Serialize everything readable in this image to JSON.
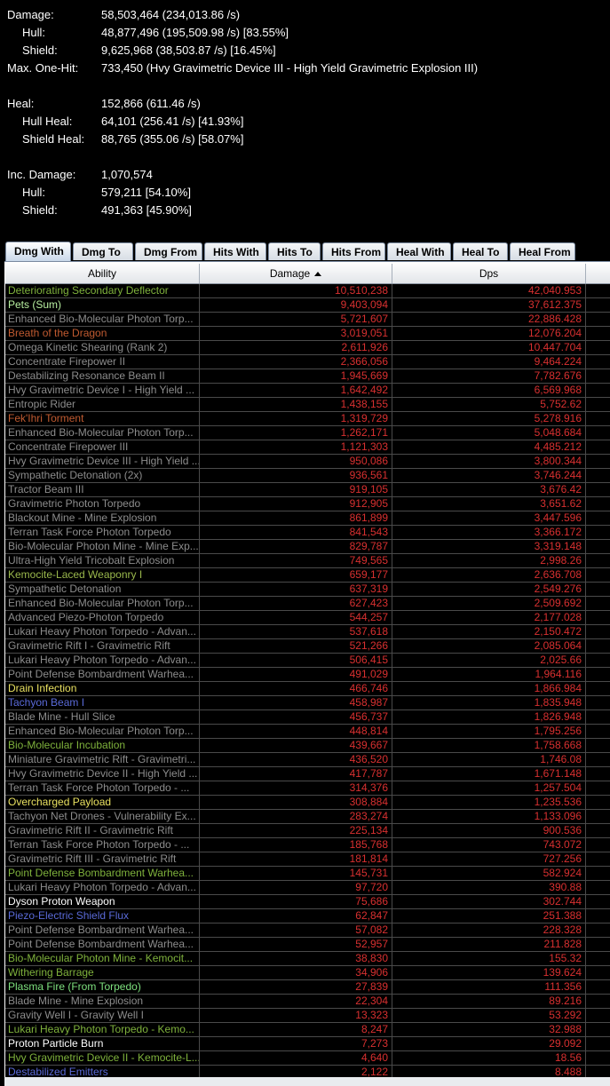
{
  "summary": {
    "damage": {
      "label": "Damage:",
      "value": "58,503,464 (234,013.86 /s)"
    },
    "damage_hull": {
      "label": "Hull:",
      "value": "48,877,496 (195,509.98 /s) [83.55%]"
    },
    "damage_shield": {
      "label": "Shield:",
      "value": "9,625,968 (38,503.87 /s) [16.45%]"
    },
    "max_one_hit": {
      "label": "Max. One-Hit:",
      "value": "733,450 (Hvy Gravimetric Device III - High Yield Gravimetric Explosion III)"
    },
    "heal": {
      "label": "Heal:",
      "value": "152,866 (611.46 /s)"
    },
    "hull_heal": {
      "label": "Hull Heal:",
      "value": "64,101 (256.41 /s) [41.93%]"
    },
    "shield_heal": {
      "label": "Shield Heal:",
      "value": "88,765 (355.06 /s) [58.07%]"
    },
    "inc_damage": {
      "label": "Inc. Damage:",
      "value": "1,070,574"
    },
    "inc_hull": {
      "label": "Hull:",
      "value": "579,211 [54.10%]"
    },
    "inc_shield": {
      "label": "Shield:",
      "value": "491,363 [45.90%]"
    }
  },
  "tabs": [
    {
      "label": "Dmg With",
      "active": true
    },
    {
      "label": "Dmg To"
    },
    {
      "label": "Dmg From"
    },
    {
      "label": "Hits With"
    },
    {
      "label": "Hits To"
    },
    {
      "label": "Hits From"
    },
    {
      "label": "Heal With"
    },
    {
      "label": "Heal To"
    },
    {
      "label": "Heal From"
    }
  ],
  "table": {
    "columns": [
      "Ability",
      "Damage",
      "Dps"
    ],
    "sort": {
      "column": "Damage",
      "direction": "descending"
    },
    "rows": [
      {
        "ability": "Deteriorating Secondary Deflector",
        "damage": "10,510,238",
        "dps": "42,040.953",
        "color": "#7fb23c"
      },
      {
        "ability": "Pets (Sum)",
        "damage": "9,403,094",
        "dps": "37,612.375",
        "color": "#b8f0a0"
      },
      {
        "ability": "Enhanced Bio-Molecular Photon Torp...",
        "damage": "5,721,607",
        "dps": "22,886.428",
        "color": "#8c8c8c"
      },
      {
        "ability": "Breath of the Dragon",
        "damage": "3,019,051",
        "dps": "12,076.204",
        "color": "#c05a30"
      },
      {
        "ability": "Omega Kinetic Shearing (Rank 2)",
        "damage": "2,611,926",
        "dps": "10,447.704",
        "color": "#8c8c8c"
      },
      {
        "ability": "Concentrate Firepower II",
        "damage": "2,366,056",
        "dps": "9,464.224",
        "color": "#8c8c8c"
      },
      {
        "ability": "Destabilizing Resonance Beam II",
        "damage": "1,945,669",
        "dps": "7,782.676",
        "color": "#8c8c8c"
      },
      {
        "ability": "Hvy Gravimetric Device I - High Yield ...",
        "damage": "1,642,492",
        "dps": "6,569.968",
        "color": "#8c8c8c"
      },
      {
        "ability": "Entropic Rider",
        "damage": "1,438,155",
        "dps": "5,752.62",
        "color": "#8c8c8c"
      },
      {
        "ability": "Fek'Ihri Torment",
        "damage": "1,319,729",
        "dps": "5,278.916",
        "color": "#c05a30"
      },
      {
        "ability": "Enhanced Bio-Molecular Photon Torp...",
        "damage": "1,262,171",
        "dps": "5,048.684",
        "color": "#8c8c8c"
      },
      {
        "ability": "Concentrate Firepower III",
        "damage": "1,121,303",
        "dps": "4,485.212",
        "color": "#8c8c8c"
      },
      {
        "ability": "Hvy Gravimetric Device III - High Yield ...",
        "damage": "950,086",
        "dps": "3,800.344",
        "color": "#8c8c8c"
      },
      {
        "ability": "Sympathetic Detonation (2x)",
        "damage": "936,561",
        "dps": "3,746.244",
        "color": "#8c8c8c"
      },
      {
        "ability": "Tractor Beam III",
        "damage": "919,105",
        "dps": "3,676.42",
        "color": "#8c8c8c"
      },
      {
        "ability": "Gravimetric Photon Torpedo",
        "damage": "912,905",
        "dps": "3,651.62",
        "color": "#8c8c8c"
      },
      {
        "ability": "Blackout Mine - Mine Explosion",
        "damage": "861,899",
        "dps": "3,447.596",
        "color": "#8c8c8c"
      },
      {
        "ability": "Terran Task Force Photon Torpedo",
        "damage": "841,543",
        "dps": "3,366.172",
        "color": "#8c8c8c"
      },
      {
        "ability": "Bio-Molecular Photon Mine - Mine Exp...",
        "damage": "829,787",
        "dps": "3,319.148",
        "color": "#8c8c8c"
      },
      {
        "ability": "Ultra-High Yield Tricobalt Explosion",
        "damage": "749,565",
        "dps": "2,998.26",
        "color": "#8c8c8c"
      },
      {
        "ability": "Kemocite-Laced Weaponry I",
        "damage": "659,177",
        "dps": "2,636.708",
        "color": "#9ab84c"
      },
      {
        "ability": "Sympathetic Detonation",
        "damage": "637,319",
        "dps": "2,549.276",
        "color": "#8c8c8c"
      },
      {
        "ability": "Enhanced Bio-Molecular Photon Torp...",
        "damage": "627,423",
        "dps": "2,509.692",
        "color": "#8c8c8c"
      },
      {
        "ability": "Advanced Piezo-Photon Torpedo",
        "damage": "544,257",
        "dps": "2,177.028",
        "color": "#8c8c8c"
      },
      {
        "ability": "Lukari Heavy Photon Torpedo - Advan...",
        "damage": "537,618",
        "dps": "2,150.472",
        "color": "#8c8c8c"
      },
      {
        "ability": "Gravimetric Rift I - Gravimetric Rift",
        "damage": "521,266",
        "dps": "2,085.064",
        "color": "#8c8c8c"
      },
      {
        "ability": "Lukari Heavy Photon Torpedo - Advan...",
        "damage": "506,415",
        "dps": "2,025.66",
        "color": "#8c8c8c"
      },
      {
        "ability": "Point Defense Bombardment Warhea...",
        "damage": "491,029",
        "dps": "1,964.116",
        "color": "#8c8c8c"
      },
      {
        "ability": "Drain Infection",
        "damage": "466,746",
        "dps": "1,866.984",
        "color": "#e8e060"
      },
      {
        "ability": "Tachyon Beam I",
        "damage": "458,987",
        "dps": "1,835.948",
        "color": "#5a6ad8"
      },
      {
        "ability": "Blade Mine - Hull Slice",
        "damage": "456,737",
        "dps": "1,826.948",
        "color": "#8c8c8c"
      },
      {
        "ability": "Enhanced Bio-Molecular Photon Torp...",
        "damage": "448,814",
        "dps": "1,795.256",
        "color": "#8c8c8c"
      },
      {
        "ability": "Bio-Molecular Incubation",
        "damage": "439,667",
        "dps": "1,758.668",
        "color": "#7fb23c"
      },
      {
        "ability": "Miniature Gravimetric Rift - Gravimetri...",
        "damage": "436,520",
        "dps": "1,746.08",
        "color": "#8c8c8c"
      },
      {
        "ability": "Hvy Gravimetric Device II - High Yield ...",
        "damage": "417,787",
        "dps": "1,671.148",
        "color": "#8c8c8c"
      },
      {
        "ability": "Terran Task Force Photon Torpedo - ...",
        "damage": "314,376",
        "dps": "1,257.504",
        "color": "#8c8c8c"
      },
      {
        "ability": "Overcharged Payload",
        "damage": "308,884",
        "dps": "1,235.536",
        "color": "#e8e060"
      },
      {
        "ability": "Tachyon Net Drones - Vulnerability Ex...",
        "damage": "283,274",
        "dps": "1,133.096",
        "color": "#8c8c8c"
      },
      {
        "ability": "Gravimetric Rift II - Gravimetric Rift",
        "damage": "225,134",
        "dps": "900.536",
        "color": "#8c8c8c"
      },
      {
        "ability": "Terran Task Force Photon Torpedo - ...",
        "damage": "185,768",
        "dps": "743.072",
        "color": "#8c8c8c"
      },
      {
        "ability": "Gravimetric Rift III - Gravimetric Rift",
        "damage": "181,814",
        "dps": "727.256",
        "color": "#8c8c8c"
      },
      {
        "ability": "Point Defense Bombardment Warhea...",
        "damage": "145,731",
        "dps": "582.924",
        "color": "#7fb23c"
      },
      {
        "ability": "Lukari Heavy Photon Torpedo - Advan...",
        "damage": "97,720",
        "dps": "390.88",
        "color": "#8c8c8c"
      },
      {
        "ability": "Dyson Proton Weapon",
        "damage": "75,686",
        "dps": "302.744",
        "color": "#ffffff"
      },
      {
        "ability": "Piezo-Electric Shield Flux",
        "damage": "62,847",
        "dps": "251.388",
        "color": "#5a6ad8"
      },
      {
        "ability": "Point Defense Bombardment Warhea...",
        "damage": "57,082",
        "dps": "228.328",
        "color": "#8c8c8c"
      },
      {
        "ability": "Point Defense Bombardment Warhea...",
        "damage": "52,957",
        "dps": "211.828",
        "color": "#8c8c8c"
      },
      {
        "ability": "Bio-Molecular Photon Mine - Kemocit...",
        "damage": "38,830",
        "dps": "155.32",
        "color": "#7fb23c"
      },
      {
        "ability": "Withering Barrage",
        "damage": "34,906",
        "dps": "139.624",
        "color": "#7fb23c"
      },
      {
        "ability": "Plasma Fire (From Torpedo)",
        "damage": "27,839",
        "dps": "111.356",
        "color": "#7ee07e"
      },
      {
        "ability": "Blade Mine - Mine Explosion",
        "damage": "22,304",
        "dps": "89.216",
        "color": "#8c8c8c"
      },
      {
        "ability": "Gravity Well I - Gravity Well I",
        "damage": "13,323",
        "dps": "53.292",
        "color": "#8c8c8c"
      },
      {
        "ability": "Lukari Heavy Photon Torpedo - Kemo...",
        "damage": "8,247",
        "dps": "32.988",
        "color": "#7fb23c"
      },
      {
        "ability": "Proton Particle Burn",
        "damage": "7,273",
        "dps": "29.092",
        "color": "#ffffff"
      },
      {
        "ability": "Hvy Gravimetric Device II - Kemocite-L...",
        "damage": "4,640",
        "dps": "18.56",
        "color": "#7fb23c"
      },
      {
        "ability": "Destabilized Emitters",
        "damage": "2,122",
        "dps": "8.488",
        "color": "#5a6ad8"
      }
    ]
  },
  "icons": {
    "sort": "sort-ascending-arrow-icon"
  }
}
